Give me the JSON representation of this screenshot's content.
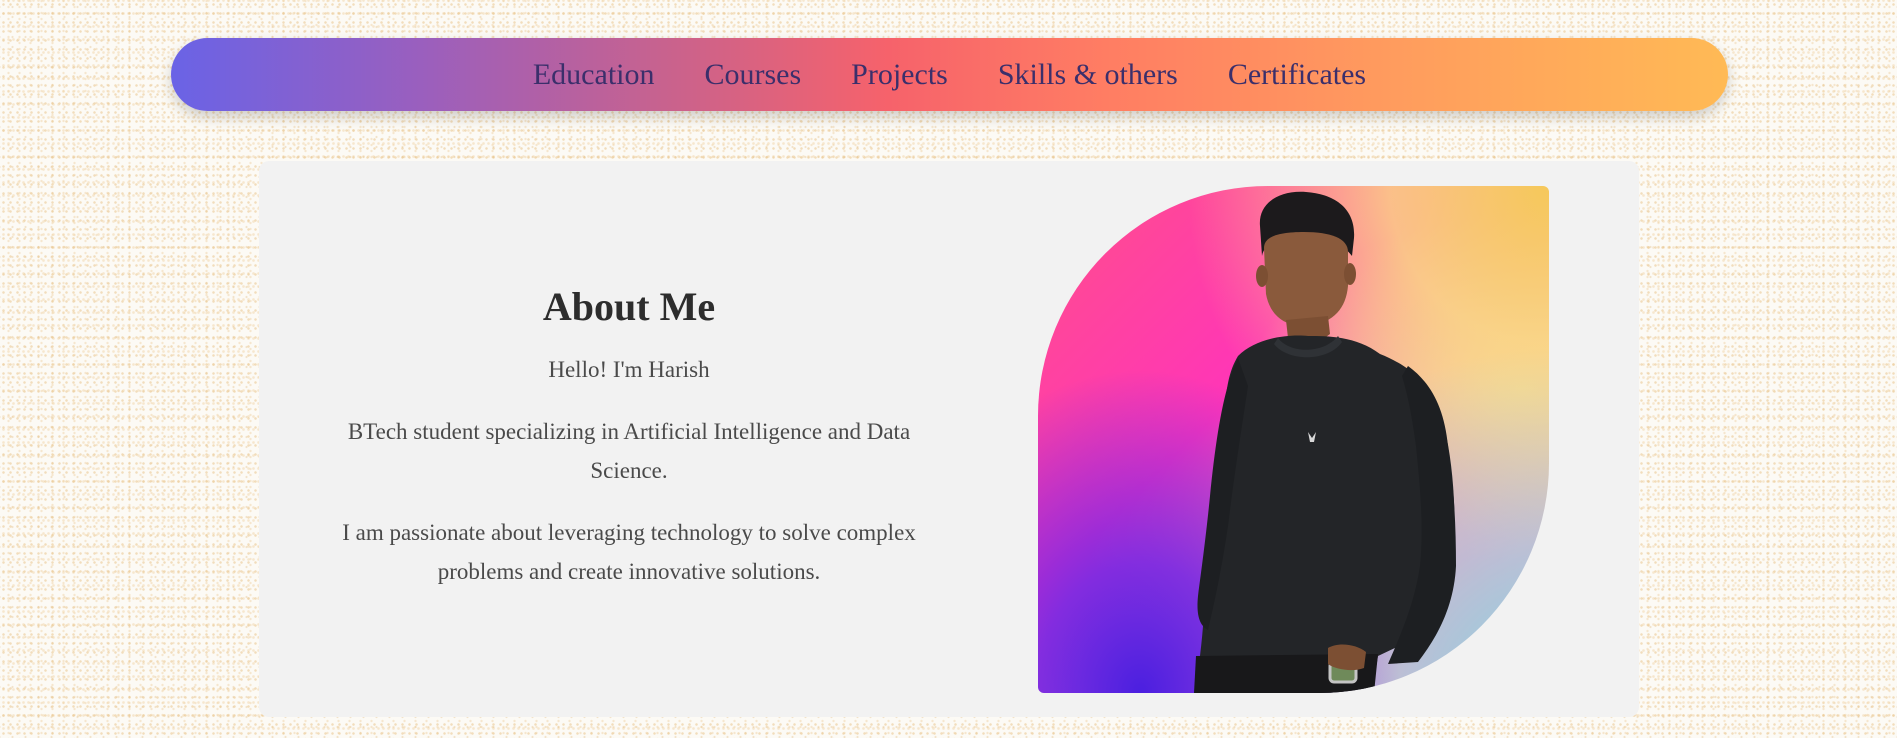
{
  "nav": {
    "items": [
      {
        "label": "Education"
      },
      {
        "label": "Courses"
      },
      {
        "label": "Projects"
      },
      {
        "label": "Skills & others"
      },
      {
        "label": "Certificates"
      }
    ]
  },
  "about": {
    "title": "About Me",
    "greeting": "Hello! I'm Harish",
    "paragraph1": "BTech student specializing in Artificial Intelligence and Data Science.",
    "paragraph2": "I am passionate about leveraging technology to solve complex problems and create innovative solutions."
  },
  "photo": {
    "icon": "profile-photo"
  },
  "colors": {
    "nav_gradient_start": "#6a63e6",
    "nav_gradient_mid": "#f6626b",
    "nav_gradient_end": "#ffba55",
    "nav_text": "#3b2f6b",
    "card_background": "#f2f2f2",
    "title_text": "#2d2d2d",
    "body_text": "#4a4a4a"
  }
}
